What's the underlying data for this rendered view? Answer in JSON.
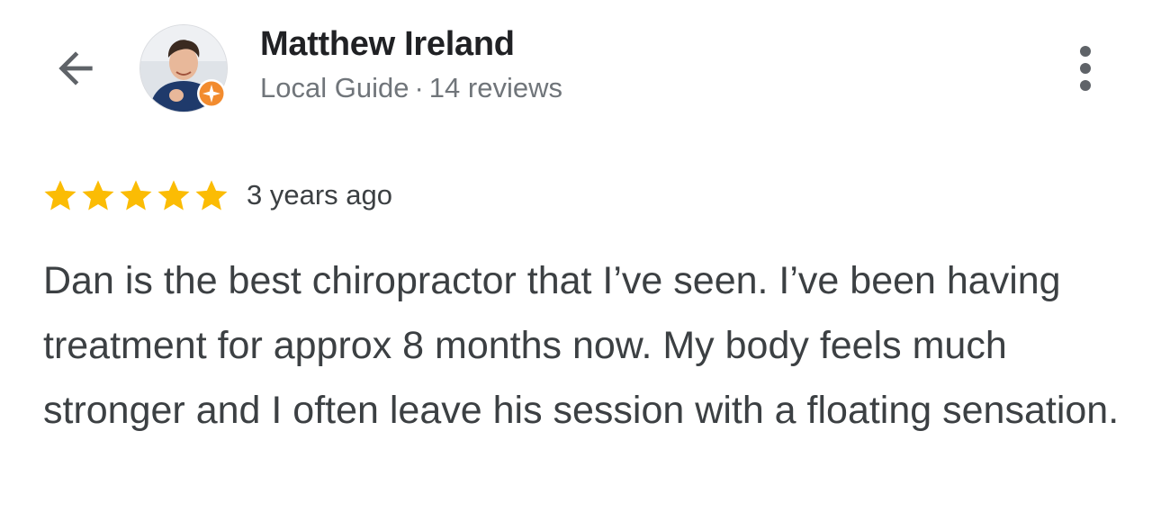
{
  "reviewer": {
    "name": "Matthew Ireland",
    "level": "Local Guide",
    "separator": "·",
    "review_count": "14 reviews"
  },
  "icons": {
    "back": "arrow-back-icon",
    "more": "more-vert-icon",
    "badge": "local-guide-badge-icon",
    "star": "star-icon"
  },
  "rating": {
    "stars": 5,
    "max": 5,
    "time_ago": "3 years ago"
  },
  "review": {
    "text": "Dan is the best chiropractor that I’ve seen. I’ve been having treatment for approx 8 months now. My body feels much stronger and I often leave his session with a floating sensation."
  },
  "colors": {
    "star": "#fbbc04",
    "badge": "#f28b2e",
    "name": "#202124",
    "meta": "#70757a",
    "body_text": "#3c4043"
  }
}
